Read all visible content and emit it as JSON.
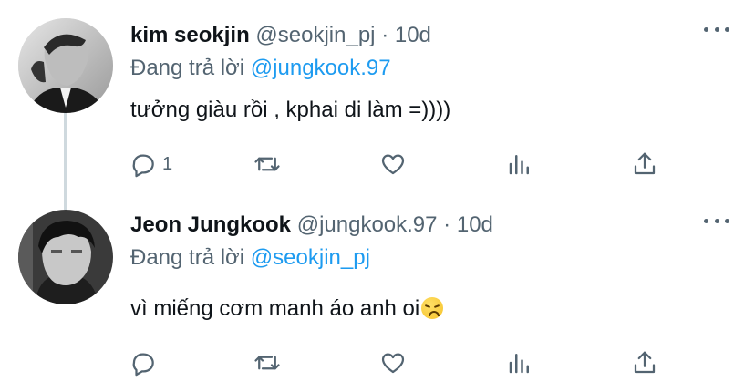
{
  "tweets": [
    {
      "name": "kim seokjin",
      "handle": "@seokjin_pj",
      "separator": "·",
      "time": "10d",
      "reply_prefix": "Đang trả lời",
      "reply_to": "@jungkook.97",
      "text": "tưởng giàu rồi , kphai di làm =))))",
      "reply_count": "1",
      "avatar": "avatar-seokjin"
    },
    {
      "name": "Jeon Jungkook",
      "handle": "@jungkook.97",
      "separator": "·",
      "time": "10d",
      "reply_prefix": "Đang trả lời",
      "reply_to": "@seokjin_pj",
      "text": "vì miếng cơm manh áo anh oi",
      "emoji": "disappointed-face",
      "reply_count": "",
      "avatar": "avatar-jungkook"
    }
  ],
  "icons": {
    "reply": "reply-icon",
    "retweet": "retweet-icon",
    "like": "like-icon",
    "stats": "stats-icon",
    "share": "share-icon",
    "more": "more-icon"
  },
  "colors": {
    "text": "#0f1419",
    "secondary": "#536471",
    "mention": "#1d9bf0",
    "thread_line": "#cfd9de"
  }
}
